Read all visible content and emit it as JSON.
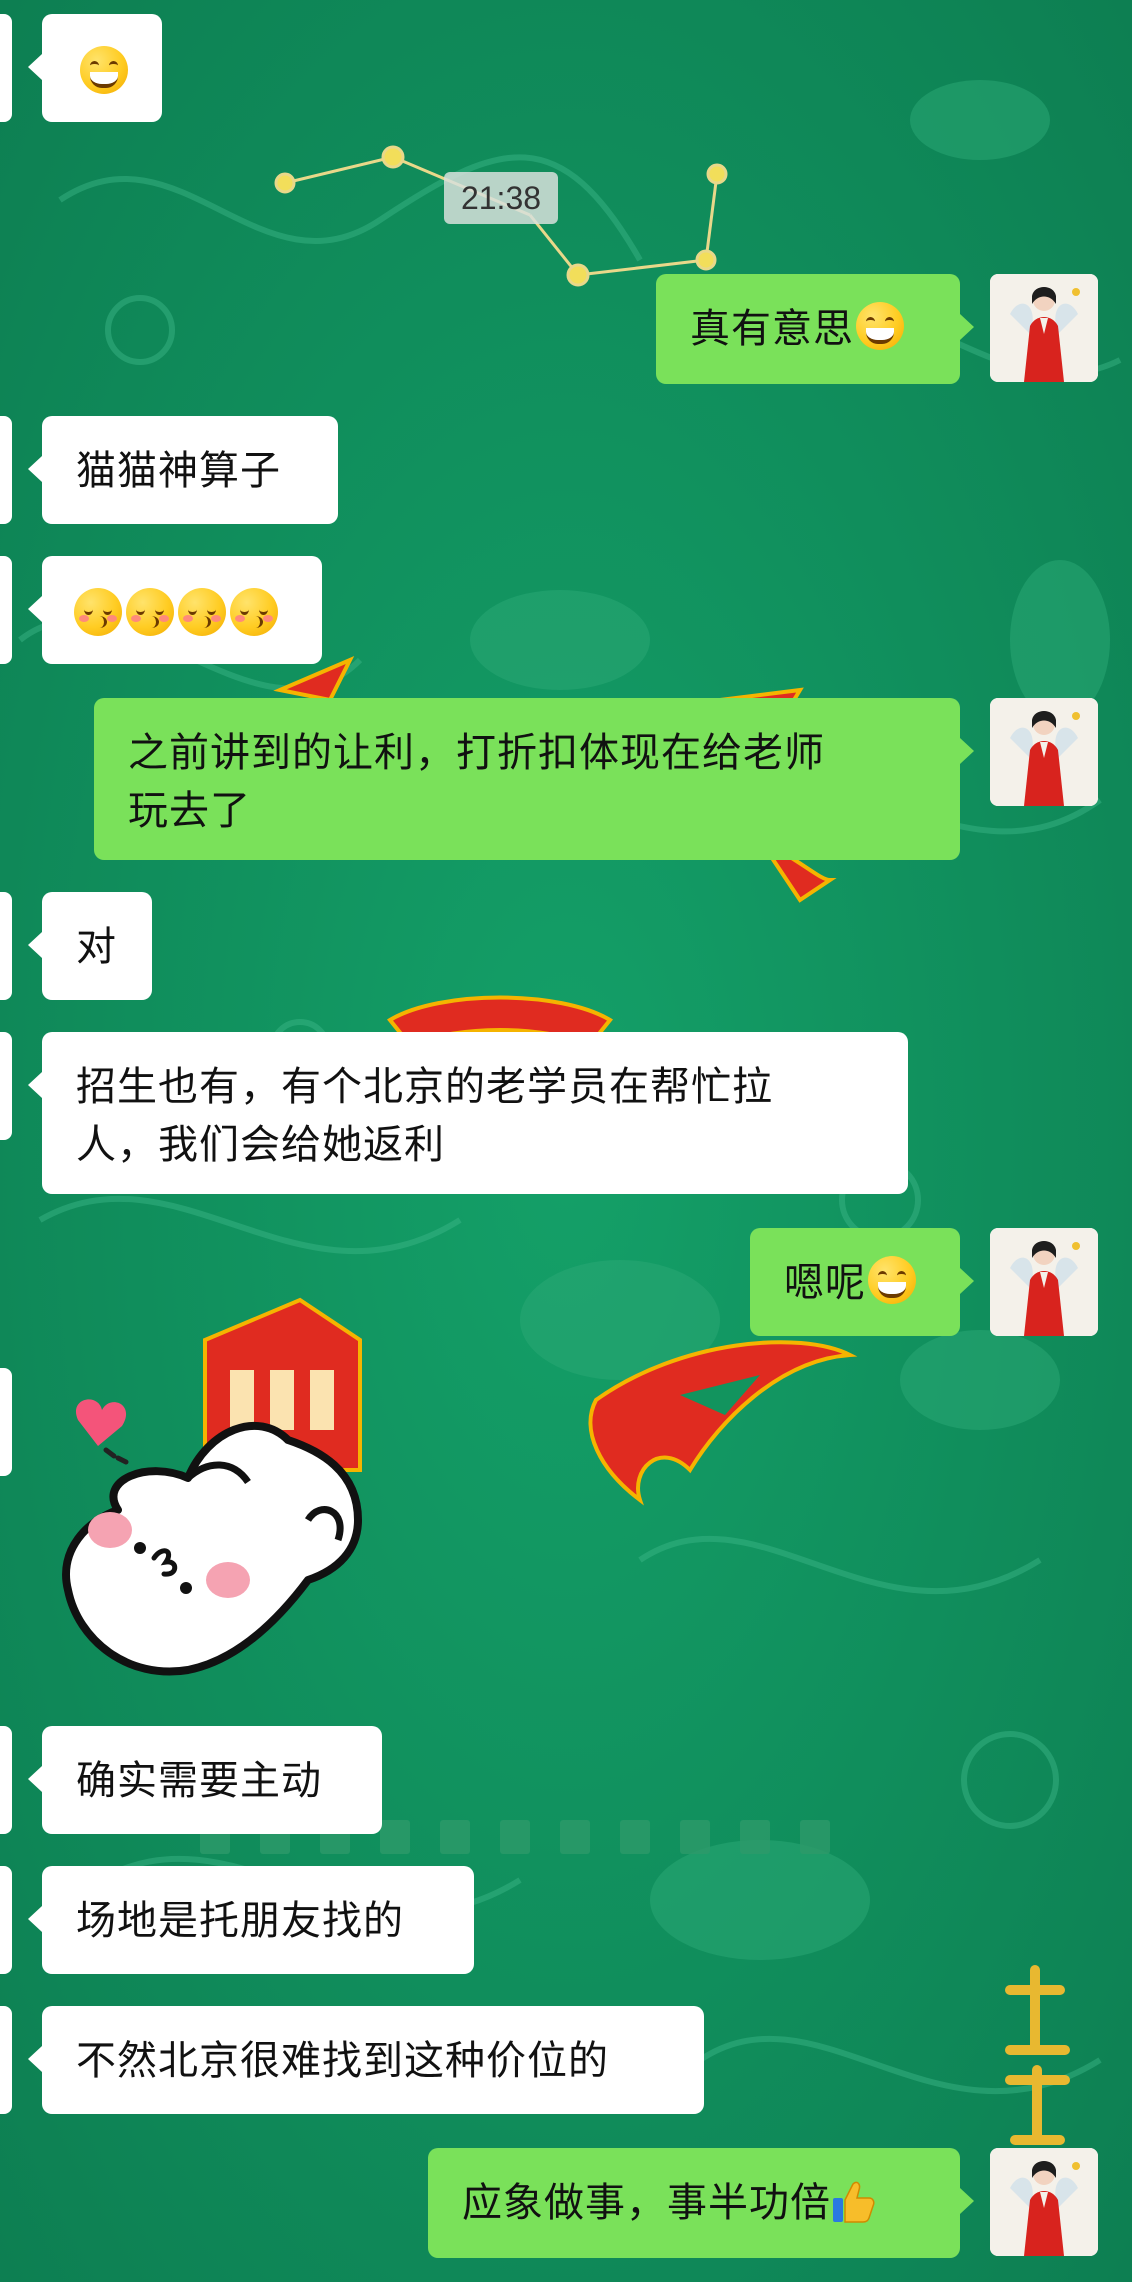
{
  "chat": {
    "timestamp": "21:38",
    "messages": [
      {
        "id": "m1",
        "side": "left",
        "text": ""
      },
      {
        "id": "m2",
        "side": "right",
        "text": "真有意思"
      },
      {
        "id": "m3",
        "side": "left",
        "text": "猫猫神算子"
      },
      {
        "id": "m4",
        "side": "left",
        "text": ""
      },
      {
        "id": "m5",
        "side": "right",
        "text_line1": "之前讲到的让利，打折扣体现在给老师",
        "text_line2": "玩去了"
      },
      {
        "id": "m6",
        "side": "left",
        "text": "对"
      },
      {
        "id": "m7",
        "side": "left",
        "text_line1": "招生也有，有个北京的老学员在帮忙拉",
        "text_line2": "人，我们会给她返利"
      },
      {
        "id": "m8",
        "side": "right",
        "text": "嗯呢"
      },
      {
        "id": "m9",
        "side": "left",
        "sticker": "bunny-heart-sticker"
      },
      {
        "id": "m10",
        "side": "left",
        "text": "确实需要主动"
      },
      {
        "id": "m11",
        "side": "left",
        "text": "场地是托朋友找的"
      },
      {
        "id": "m12",
        "side": "left",
        "text": "不然北京很难找到这种价位的"
      },
      {
        "id": "m13",
        "side": "right",
        "text": "应象做事，事半功倍"
      }
    ]
  },
  "icons": {
    "grin": "grinning-emoji-icon",
    "kiss": "kissing-emoji-icon",
    "thumbs": "thumbs-up-icon",
    "avatar": "user-avatar-red-hanfu"
  },
  "colors": {
    "background": "#12945e",
    "incoming_bubble": "#ffffff",
    "outgoing_bubble": "#7ae15a",
    "text": "#111111"
  }
}
